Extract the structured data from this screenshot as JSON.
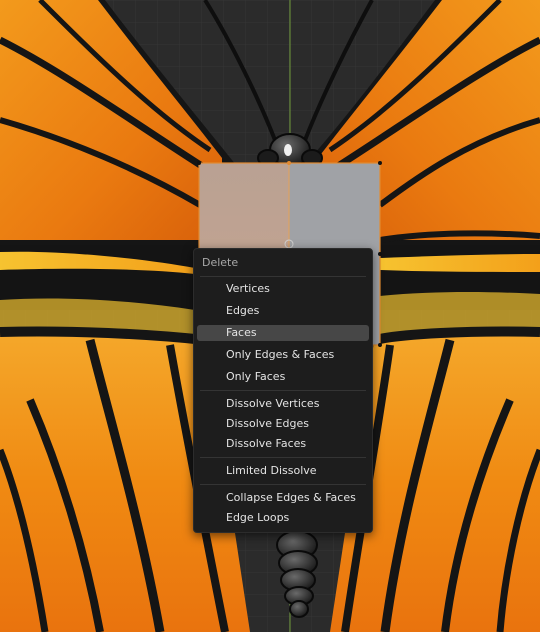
{
  "viewport": {
    "background": "#2b2b2b",
    "grid_color": "#373737",
    "axis_color": "#6f9a3a",
    "wing_orange": "#f08a12",
    "wing_vein": "#151515",
    "selection_outline": "#e28a30"
  },
  "menu": {
    "title": "Delete",
    "highlighted_item": "Faces",
    "groups": [
      [
        "Vertices",
        "Edges",
        "Faces",
        "Only Edges & Faces",
        "Only Faces"
      ],
      [
        "Dissolve Vertices",
        "Dissolve Edges",
        "Dissolve Faces"
      ],
      [
        "Limited Dissolve"
      ],
      [
        "Collapse Edges & Faces",
        "Edge Loops"
      ]
    ],
    "items": [
      {
        "label": "Vertices"
      },
      {
        "label": "Edges"
      },
      {
        "label": "Faces"
      },
      {
        "label": "Only Edges & Faces"
      },
      {
        "label": "Only Faces"
      },
      {
        "label": "Dissolve Vertices"
      },
      {
        "label": "Dissolve Edges"
      },
      {
        "label": "Dissolve Faces"
      },
      {
        "label": "Limited Dissolve"
      },
      {
        "label": "Collapse Edges & Faces"
      },
      {
        "label": "Edge Loops"
      }
    ]
  }
}
